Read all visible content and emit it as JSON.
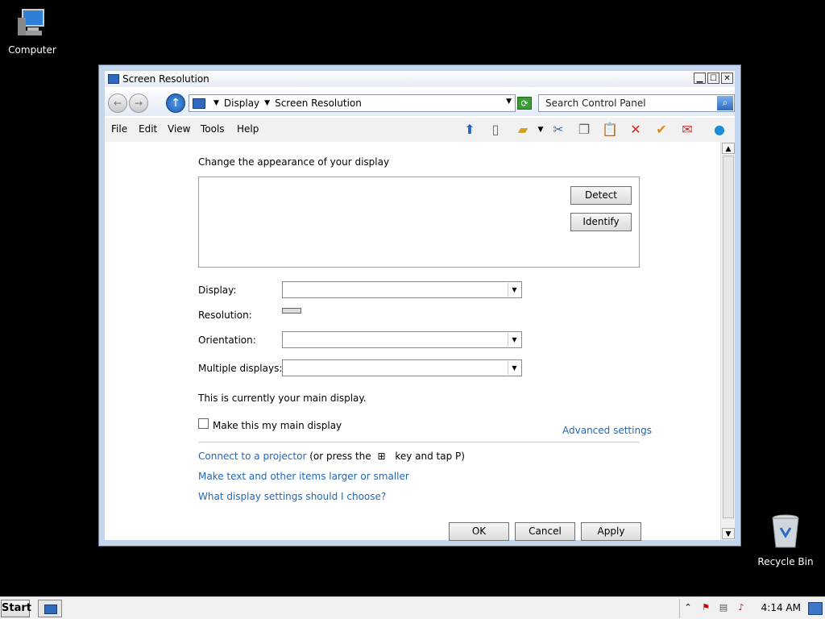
{
  "desktop": {
    "computer_label": "Computer",
    "recycle_label": "Recycle Bin"
  },
  "window": {
    "title": "Screen Resolution",
    "minimize": "▁",
    "maximize": "☐",
    "close": "✕",
    "breadcrumb": [
      "Display",
      "Screen Resolution"
    ],
    "search_placeholder": "Search Control Panel",
    "menu": [
      "File",
      "Edit",
      "View",
      "Tools",
      "Help"
    ]
  },
  "content": {
    "heading": "Change the appearance of your display",
    "detect": "Detect",
    "identify": "Identify",
    "display_label": "Display:",
    "resolution_label": "Resolution:",
    "orientation_label": "Orientation:",
    "multiple_label": "Multiple displays:",
    "main_display_text": "This is currently your main display.",
    "make_main": "Make this my main display",
    "advanced": "Advanced settings",
    "projector_link": "Connect to a projector",
    "projector_suffix_a": "(or press the",
    "projector_suffix_b": "key and tap P)",
    "larger_link": "Make text and other items larger or smaller",
    "choose_link": "What display settings should I choose?",
    "ok": "OK",
    "cancel": "Cancel",
    "apply": "Apply"
  },
  "taskbar": {
    "start": "Start",
    "clock": "4:14 AM"
  }
}
